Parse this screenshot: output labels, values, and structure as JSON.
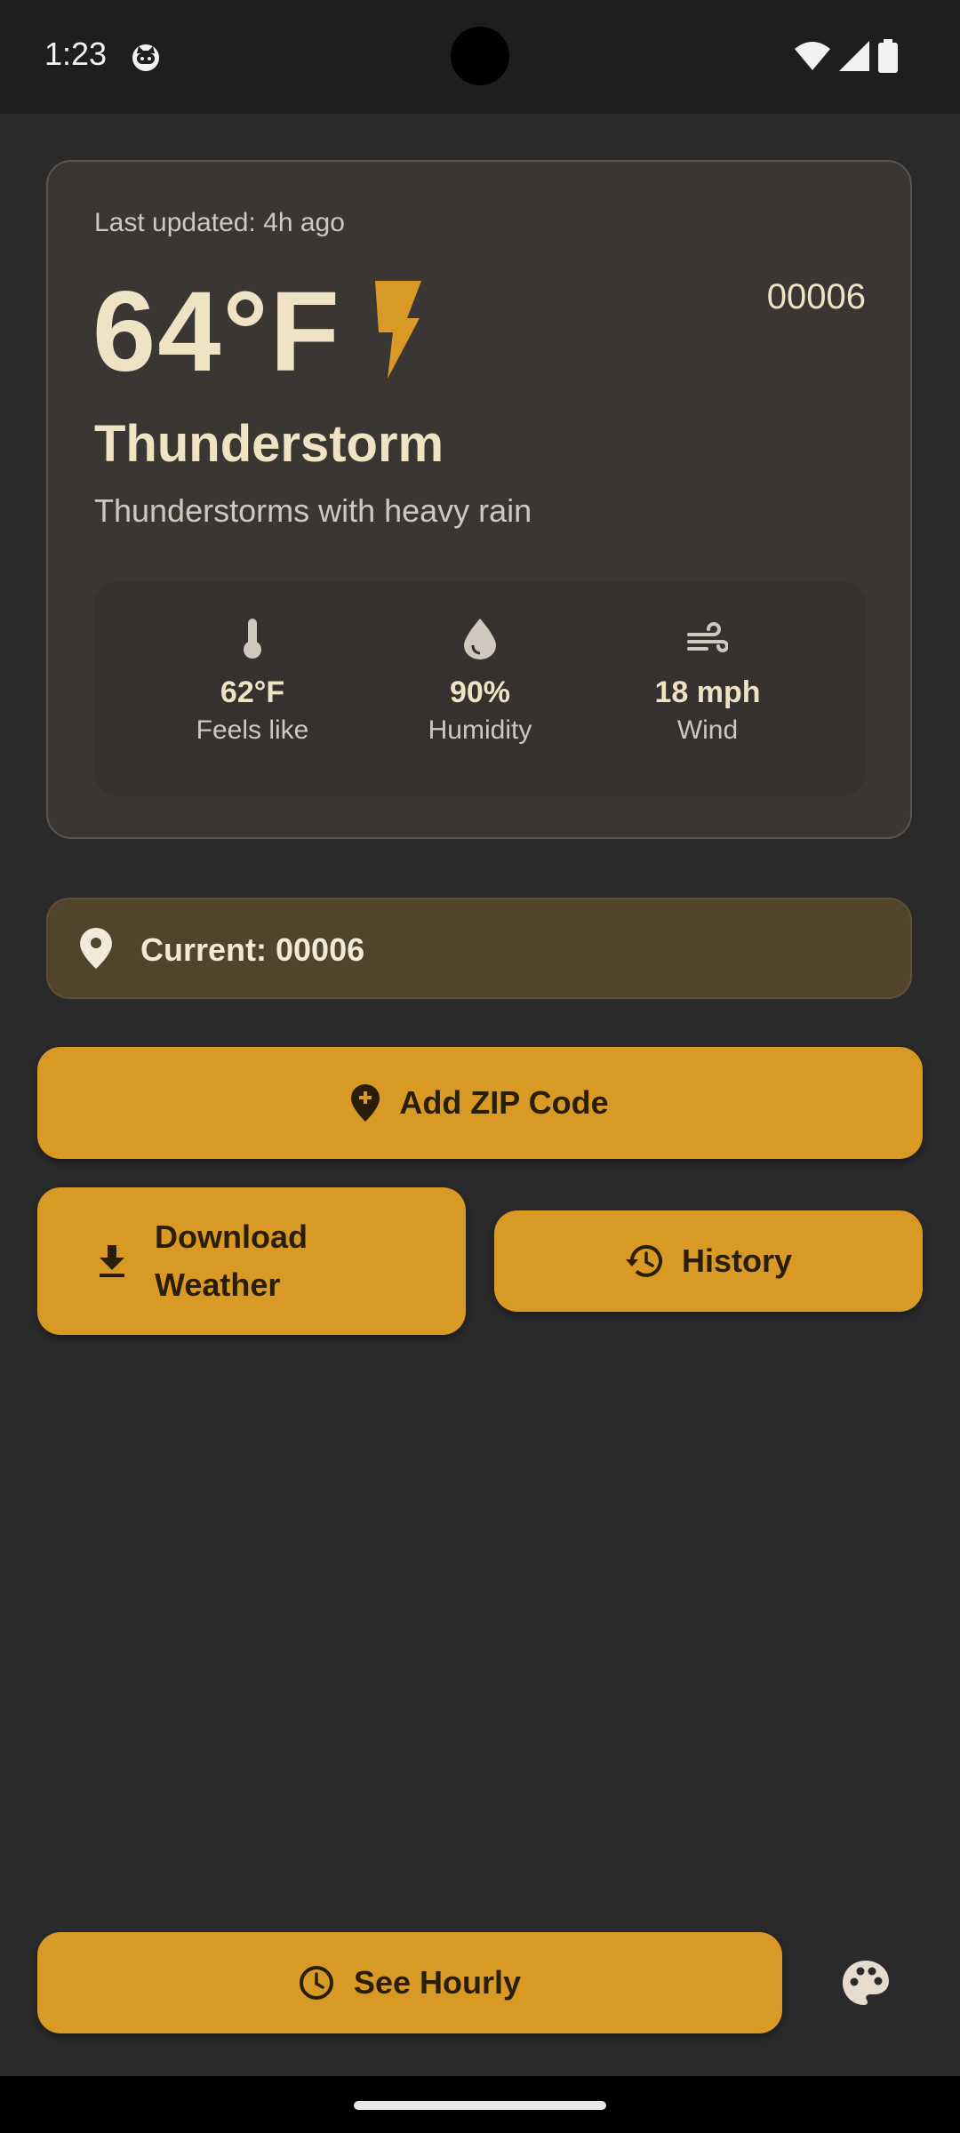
{
  "status_bar": {
    "time": "1:23"
  },
  "weather": {
    "last_updated": "Last updated: 4h ago",
    "temperature": "64°F",
    "zip": "00006",
    "condition": "Thunderstorm",
    "description": "Thunderstorms with heavy rain",
    "icon": "lightning-bolt-icon",
    "stats": [
      {
        "icon": "thermometer-icon",
        "value": "62°F",
        "label": "Feels like"
      },
      {
        "icon": "water-drop-icon",
        "value": "90%",
        "label": "Humidity"
      },
      {
        "icon": "wind-icon",
        "value": "18 mph",
        "label": "Wind"
      }
    ]
  },
  "current_location": {
    "label": "Current: 00006",
    "icon": "location-pin-icon"
  },
  "buttons": {
    "add_zip": "Add ZIP Code",
    "download": "Download Weather",
    "history": "History",
    "see_hourly": "See Hourly"
  },
  "colors": {
    "accent": "#d89a24",
    "background": "#2a2a2a",
    "card": "#3a3634",
    "text_primary": "#f0e3c4"
  }
}
